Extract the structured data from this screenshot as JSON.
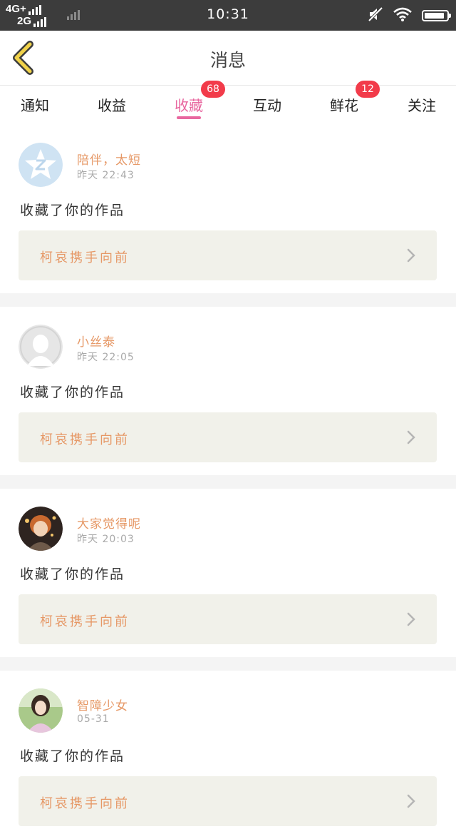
{
  "status_bar": {
    "network_top": "4G+",
    "network_bottom": "2G",
    "time": "10:31",
    "icons": [
      "mute-icon",
      "wifi-icon",
      "battery-icon"
    ],
    "battery_level": 0.92
  },
  "header": {
    "title": "消息",
    "back_icon": "chevron-left-icon"
  },
  "tabs": [
    {
      "label": "通知"
    },
    {
      "label": "收益"
    },
    {
      "label": "收藏",
      "badge": "68",
      "active": true
    },
    {
      "label": "互动"
    },
    {
      "label": "鲜花",
      "badge": "12"
    },
    {
      "label": "关注"
    }
  ],
  "messages": [
    {
      "username": "陪伴，太短",
      "time": "昨天 22:43",
      "action": "收藏了你的作品",
      "work_title": "柯哀携手向前",
      "avatar": "qq-star-avatar"
    },
    {
      "username": "小丝泰",
      "time": "昨天 22:05",
      "action": "收藏了你的作品",
      "work_title": "柯哀携手向前",
      "avatar": "default-avatar"
    },
    {
      "username": "大家觉得呢",
      "time": "昨天 20:03",
      "action": "收藏了你的作品",
      "work_title": "柯哀携手向前",
      "avatar": "anime-avatar"
    },
    {
      "username": "智障少女",
      "time": "05-31",
      "action": "收藏了你的作品",
      "work_title": "柯哀携手向前",
      "avatar": "girl-photo-avatar"
    }
  ],
  "colors": {
    "accent": "#e8679f",
    "badge": "#f23b4a",
    "username": "#e69866",
    "link_bg": "#f1f1ea",
    "back_icon": "#f0d24a"
  }
}
